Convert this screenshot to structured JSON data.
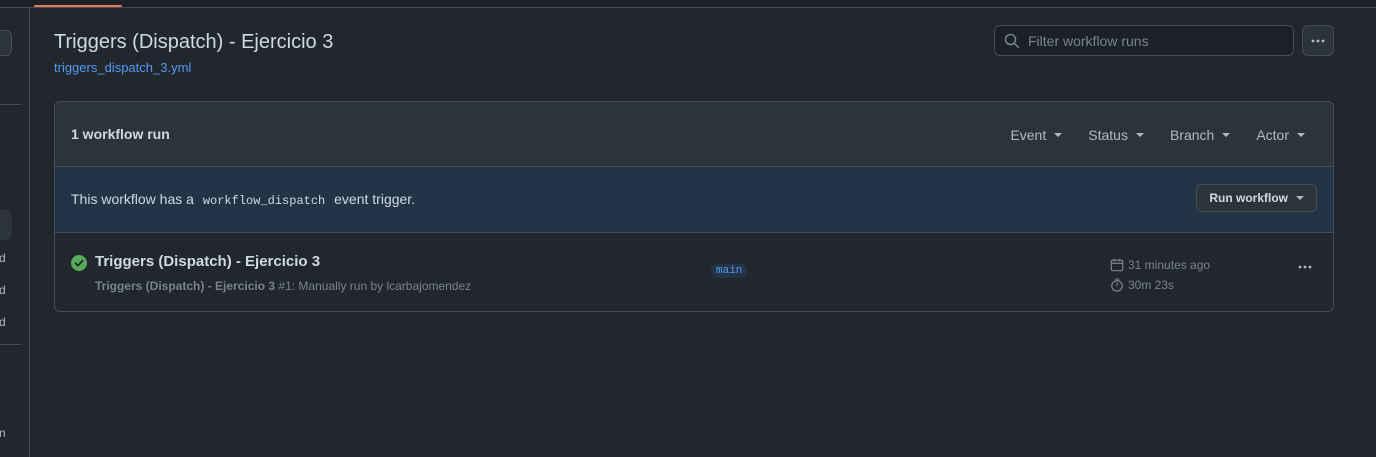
{
  "page": {
    "title": "Triggers (Dispatch) - Ejercicio 3",
    "workflow_file": "triggers_dispatch_3.yml"
  },
  "search": {
    "placeholder": "Filter workflow runs",
    "value": ""
  },
  "sidebar_fragments": [
    "d",
    "d",
    "d",
    "n"
  ],
  "runs_box": {
    "count_label": "1 workflow run",
    "filters": [
      "Event",
      "Status",
      "Branch",
      "Actor"
    ]
  },
  "dispatch": {
    "prefix": "This workflow has a",
    "code": "workflow_dispatch",
    "suffix": "event trigger.",
    "button_label": "Run workflow"
  },
  "runs": [
    {
      "status": "success",
      "title": "Triggers (Dispatch) - Ejercicio 3",
      "workflow_name": "Triggers (Dispatch) - Ejercicio 3",
      "detail": "#1: Manually run by lcarbajomendez",
      "branch": "main",
      "time_ago": "31 minutes ago",
      "duration": "30m 23s"
    }
  ],
  "colors": {
    "background": "#22272e",
    "accent_link": "#539bf5",
    "success": "#57ab5a",
    "tab_underline": "#ec775c"
  }
}
